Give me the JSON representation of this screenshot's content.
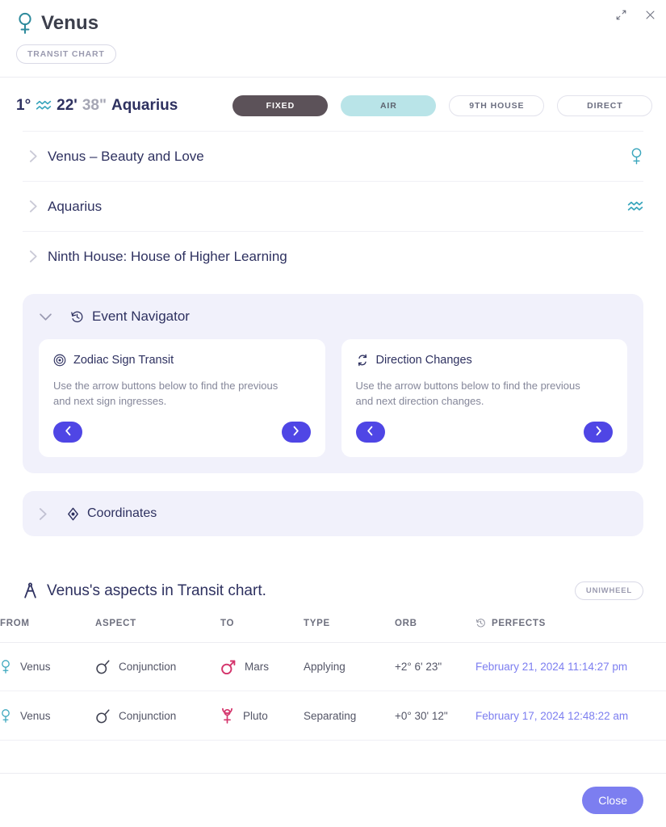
{
  "window": {
    "expand_icon": "expand-icon",
    "close_icon": "close-icon"
  },
  "header": {
    "title": "Venus",
    "planet_icon": "venus-glyph-icon",
    "chart_badge": "TRANSIT CHART"
  },
  "position": {
    "degree": "1°",
    "sign_glyph": "aquarius-glyph-icon",
    "minutes": "22'",
    "seconds": "38\"",
    "sign": "Aquarius",
    "chips": [
      {
        "label": "FIXED",
        "style": "dark"
      },
      {
        "label": "AIR",
        "style": "air"
      },
      {
        "label": "9TH HOUSE",
        "style": "plain"
      },
      {
        "label": "DIRECT",
        "style": "plain"
      }
    ]
  },
  "accordions": [
    {
      "label": "Venus – Beauty and Love",
      "right_icon": "venus-glyph-icon",
      "expanded": false
    },
    {
      "label": "Aquarius",
      "right_icon": "aquarius-glyph-icon",
      "expanded": false
    },
    {
      "label": "Ninth House: House of Higher Learning",
      "right_icon": "none",
      "expanded": false
    }
  ],
  "event_navigator": {
    "title": "Event Navigator",
    "icon": "history-clock-icon",
    "expanded": true,
    "cards": [
      {
        "icon": "zodiac-target-icon",
        "title": "Zodiac Sign Transit",
        "description": "Use the arrow buttons below to find the previous and next sign ingresses.",
        "prev_icon": "chevron-left-icon",
        "next_icon": "chevron-right-icon"
      },
      {
        "icon": "direction-swap-icon",
        "title": "Direction Changes",
        "description": "Use the arrow buttons below to find the previous and next direction changes.",
        "prev_icon": "chevron-left-icon",
        "next_icon": "chevron-right-icon"
      }
    ]
  },
  "coordinates": {
    "label": "Coordinates",
    "icon": "coordinates-target-icon",
    "expanded": false
  },
  "aspects": {
    "title": "Venus's aspects in Transit chart.",
    "icon": "compass-icon",
    "badge": "UNIWHEEL",
    "columns": [
      "FROM",
      "ASPECT",
      "TO",
      "TYPE",
      "ORB",
      "PERFECTS"
    ],
    "perfects_icon": "history-clock-icon",
    "rows": [
      {
        "from_icon": "venus-glyph-icon",
        "from": "Venus",
        "aspect_icon": "conjunction-glyph-icon",
        "aspect": "Conjunction",
        "to_icon": "mars-glyph-icon",
        "to": "Mars",
        "type": "Applying",
        "orb": "+2° 6' 23\"",
        "perfects": "February 21, 2024 11:14:27 pm"
      },
      {
        "from_icon": "venus-glyph-icon",
        "from": "Venus",
        "aspect_icon": "conjunction-glyph-icon",
        "aspect": "Conjunction",
        "to_icon": "pluto-glyph-icon",
        "to": "Pluto",
        "type": "Separating",
        "orb": "+0° 30' 12\"",
        "perfects": "February 17, 2024 12:48:22 am"
      }
    ]
  },
  "footer": {
    "close_label": "Close"
  },
  "colors": {
    "accent_indigo": "#4f46e5",
    "close_button": "#7c7ef0",
    "teal_glyph": "#3aa6bd",
    "crimson_glyph": "#d4356c",
    "panel_lavender": "#f1f1fb",
    "chip_dark": "#5c5259",
    "chip_air": "#b9e4e8",
    "navy_text": "#2e3160"
  }
}
